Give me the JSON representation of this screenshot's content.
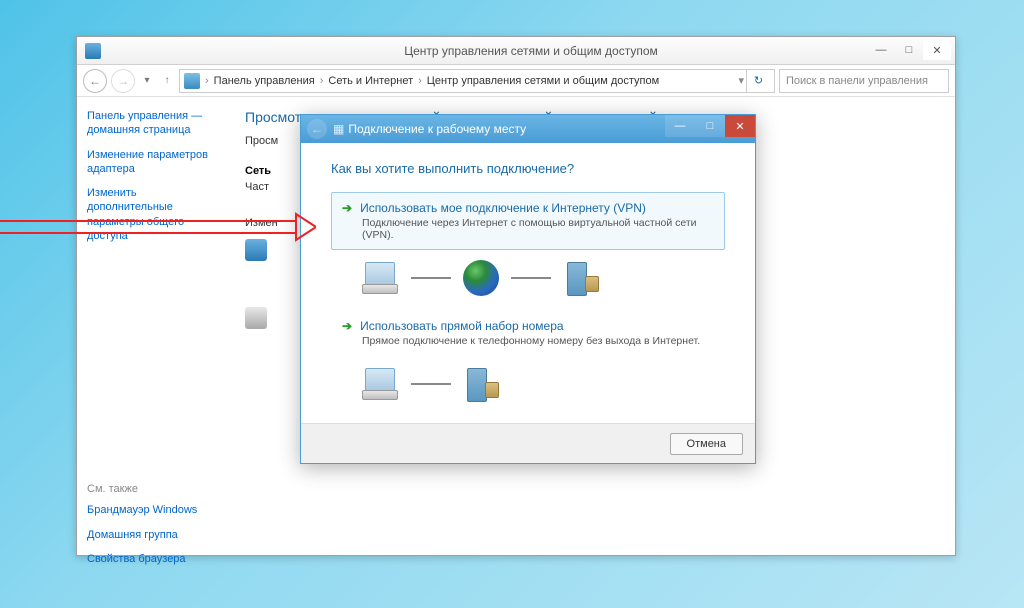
{
  "window": {
    "title": "Центр управления сетями и общим доступом"
  },
  "breadcrumb": {
    "item1": "Панель управления",
    "item2": "Сеть и Интернет",
    "item3": "Центр управления сетями и общим доступом"
  },
  "search": {
    "placeholder": "Поиск в панели управления"
  },
  "sidebar": {
    "link1": "Панель управления — домашняя страница",
    "link2": "Изменение параметров адаптера",
    "link3": "Изменить дополнительные параметры общего доступа",
    "see_also": "См. также",
    "link4": "Брандмауэр Windows",
    "link5": "Домашняя группа",
    "link6": "Свойства браузера"
  },
  "main": {
    "title": "Просмотр основных сведений о сети и настройка подключений",
    "label_view": "Просм",
    "label_net": "Сеть",
    "label_private": "Част",
    "label_change": "Измен"
  },
  "dialog": {
    "title": "Подключение к рабочему месту",
    "question": "Как вы хотите выполнить подключение?",
    "opt1_title": "Использовать мое подключение к Интернету (VPN)",
    "opt1_desc": "Подключение через Интернет с помощью виртуальной частной сети (VPN).",
    "opt2_title": "Использовать прямой набор номера",
    "opt2_desc": "Прямое подключение к телефонному номеру без выхода в Интернет.",
    "cancel": "Отмена"
  }
}
